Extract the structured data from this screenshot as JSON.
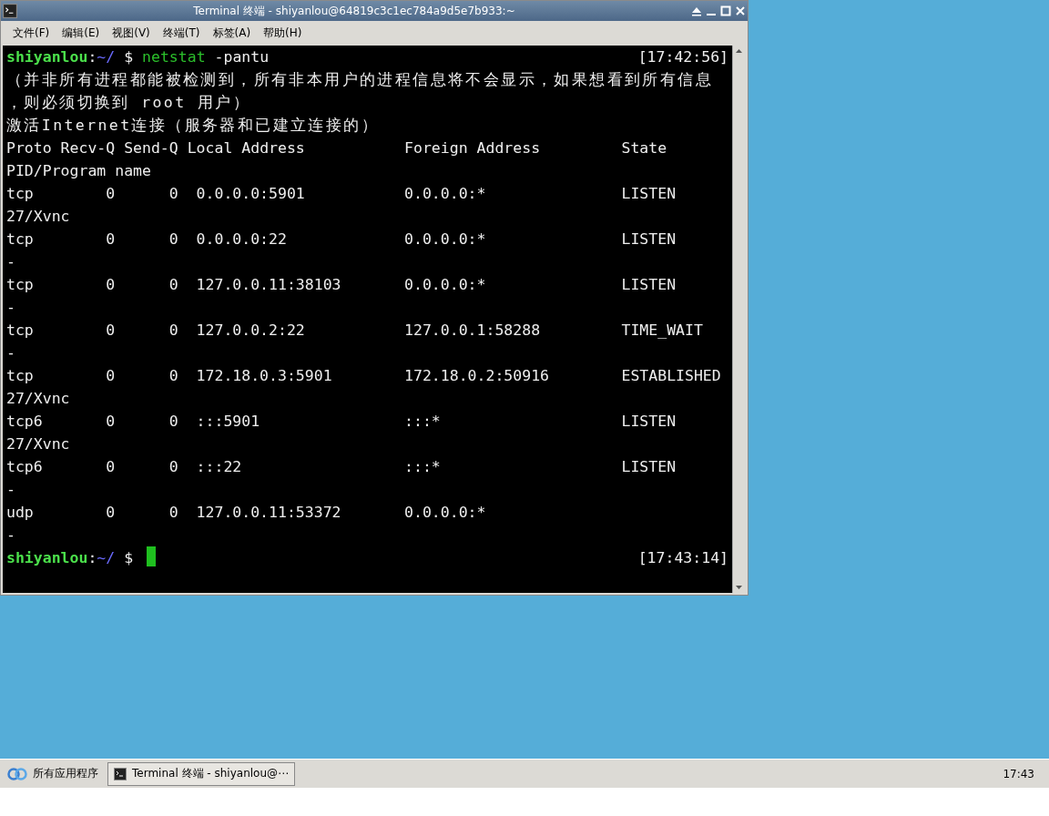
{
  "window": {
    "title": "Terminal 终端 - shiyanlou@64819c3c1ec784a9d5e7b933:~"
  },
  "menu": [
    "文件(F)",
    "编辑(E)",
    "视图(V)",
    "终端(T)",
    "标签(A)",
    "帮助(H)"
  ],
  "terminal": {
    "command_prompt": {
      "user": "shiyanlou",
      "separator": ":",
      "path": "~/",
      "sign": "$",
      "command": "netstat",
      "args": "-pantu",
      "time": "[17:42:56]"
    },
    "notice": [
      "（并非所有进程都能被检测到，所有非本用户的进程信息将不会显示，如果想看到所有信息",
      "，则必须切换到 root 用户）",
      "激活Internet连接（服务器和已建立连接的）"
    ],
    "header": [
      "Proto",
      "Recv-Q",
      "Send-Q",
      "Local Address",
      "Foreign Address",
      "State"
    ],
    "header_wrap": "PID/Program name",
    "rows": [
      {
        "proto": "tcp",
        "recv_q": "0",
        "send_q": "0",
        "local": "0.0.0.0:5901",
        "foreign": "0.0.0.0:*",
        "state": "LISTEN",
        "pid": "27/Xvnc"
      },
      {
        "proto": "tcp",
        "recv_q": "0",
        "send_q": "0",
        "local": "0.0.0.0:22",
        "foreign": "0.0.0.0:*",
        "state": "LISTEN",
        "pid": "-"
      },
      {
        "proto": "tcp",
        "recv_q": "0",
        "send_q": "0",
        "local": "127.0.0.11:38103",
        "foreign": "0.0.0.0:*",
        "state": "LISTEN",
        "pid": "-"
      },
      {
        "proto": "tcp",
        "recv_q": "0",
        "send_q": "0",
        "local": "127.0.0.2:22",
        "foreign": "127.0.0.1:58288",
        "state": "TIME_WAIT",
        "pid": "-"
      },
      {
        "proto": "tcp",
        "recv_q": "0",
        "send_q": "0",
        "local": "172.18.0.3:5901",
        "foreign": "172.18.0.2:50916",
        "state": "ESTABLISHED",
        "pid": "27/Xvnc"
      },
      {
        "proto": "tcp6",
        "recv_q": "0",
        "send_q": "0",
        "local": ":::5901",
        "foreign": ":::*",
        "state": "LISTEN",
        "pid": "27/Xvnc"
      },
      {
        "proto": "tcp6",
        "recv_q": "0",
        "send_q": "0",
        "local": ":::22",
        "foreign": ":::*",
        "state": "LISTEN",
        "pid": "-"
      },
      {
        "proto": "udp",
        "recv_q": "0",
        "send_q": "0",
        "local": "127.0.0.11:53372",
        "foreign": "0.0.0.0:*",
        "pid": "-"
      }
    ],
    "final_prompt": {
      "user": "shiyanlou",
      "separator": ":",
      "path": "~/",
      "sign": "$",
      "time": "[17:43:14]"
    }
  },
  "taskbar": {
    "start": "所有应用程序",
    "task": "Terminal 终端 - shiyanlou@⋯",
    "clock": "17:43"
  }
}
